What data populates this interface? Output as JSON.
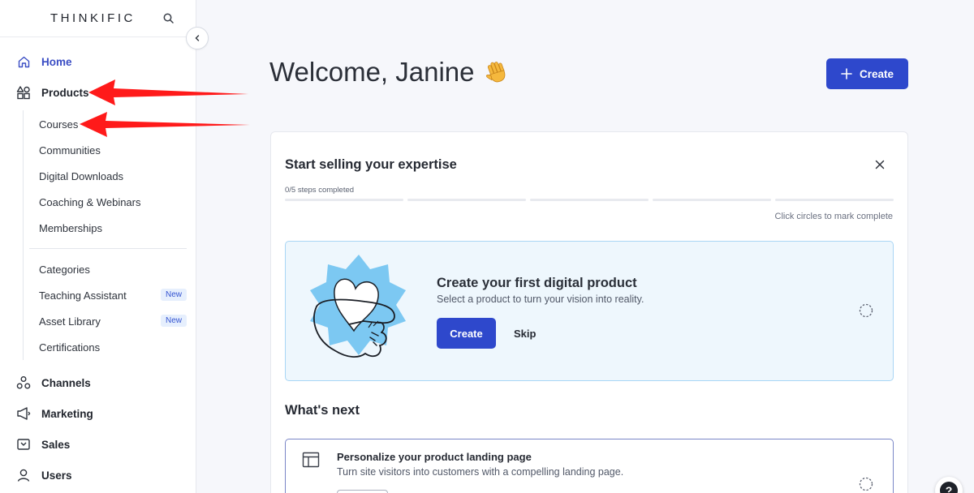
{
  "brand": {
    "name": "THINKIFIC"
  },
  "sidebar": {
    "main_items": [
      {
        "label": "Home",
        "icon": "home-icon",
        "active": true
      },
      {
        "label": "Products",
        "icon": "shapes-icon"
      },
      {
        "label": "Channels",
        "icon": "channels-icon"
      },
      {
        "label": "Marketing",
        "icon": "megaphone-icon"
      },
      {
        "label": "Sales",
        "icon": "sales-icon"
      },
      {
        "label": "Users",
        "icon": "user-icon"
      }
    ],
    "product_items": [
      {
        "label": "Courses"
      },
      {
        "label": "Communities"
      },
      {
        "label": "Digital Downloads"
      },
      {
        "label": "Coaching & Webinars"
      },
      {
        "label": "Memberships"
      },
      {
        "label": "Categories"
      },
      {
        "label": "Teaching Assistant",
        "badge": "New"
      },
      {
        "label": "Asset Library",
        "badge": "New"
      },
      {
        "label": "Certifications"
      }
    ]
  },
  "header": {
    "welcome": "Welcome, Janine",
    "create_label": "Create"
  },
  "onboarding": {
    "title": "Start selling your expertise",
    "steps_completed": "0/5 steps completed",
    "progress_fraction": 0,
    "hint": "Click circles to mark complete",
    "task": {
      "title": "Create your first digital product",
      "description": "Select a product to turn your vision into reality.",
      "create_label": "Create",
      "skip_label": "Skip"
    },
    "whats_next_title": "What's next",
    "next_item": {
      "title": "Personalize your product landing page",
      "description": "Turn site visitors into customers with a compelling landing page."
    }
  },
  "colors": {
    "accent": "#2e48cc",
    "annotation_arrow": "#ff1a1a",
    "task_bg": "#eef7fd",
    "task_border": "#a9d6f5"
  }
}
